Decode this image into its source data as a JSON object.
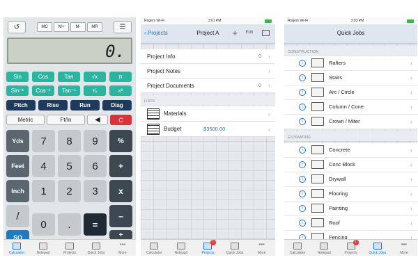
{
  "calculator": {
    "history_icon": "history-icon",
    "mem_buttons": [
      "MC",
      "M+",
      "M-",
      "MR"
    ],
    "menu_icon": "list-icon",
    "display": "0.",
    "sci_row1": [
      "Sin",
      "Cos",
      "Tan",
      "√x",
      "π"
    ],
    "sci_row2": [
      "Sin⁻¹",
      "Cos⁻¹",
      "Tan⁻¹",
      "¹⁄ₓ",
      "x²"
    ],
    "func_row": [
      "Pitch",
      "Rise",
      "Run",
      "Diag"
    ],
    "mode_row": {
      "metric": "Metric",
      "ftin": "Ft/In",
      "back": "◀",
      "clear": "C"
    },
    "side_keys": [
      "Yds",
      "Feet",
      "Inch",
      "/",
      "SQ\nCU"
    ],
    "digits": [
      [
        "7",
        "8",
        "9"
      ],
      [
        "4",
        "5",
        "6"
      ],
      [
        "1",
        "2",
        "3"
      ],
      [
        "0",
        "."
      ]
    ],
    "ops": [
      "%",
      "+",
      "x",
      "–",
      "+"
    ],
    "equals": "="
  },
  "tabs": [
    "Calculator",
    "Notepad",
    "Projects",
    "Quick Jobs",
    "More"
  ],
  "project": {
    "status_left": "Rogers Wi-Fi",
    "time": "3:01 PM",
    "back": "Projects",
    "title": "Project A",
    "edit": "Edit",
    "rows": [
      {
        "label": "Project Info",
        "count": "0"
      },
      {
        "label": "Project Notes",
        "count": ""
      },
      {
        "label": "Project Documents",
        "count": "0"
      }
    ],
    "lists_header": "LISTS",
    "materials": "Materials",
    "budget_label": "Budget",
    "budget_value": "$3500.00",
    "badge": "1"
  },
  "quickjobs": {
    "status_left": "Rogers Wi-Fi",
    "time": "3:03 PM",
    "title": "Quick Jobs",
    "construction_header": "CONSTRUCTION",
    "construction": [
      "Rafters",
      "Stairs",
      "Arc / Circle",
      "Column / Cone",
      "Crown / Miter"
    ],
    "estimating_header": "ESTIMATING",
    "estimating": [
      "Concrete",
      "Conc Block",
      "Drywall",
      "Flooring",
      "Painting",
      "Roof",
      "Fencing"
    ],
    "badge": "1"
  }
}
